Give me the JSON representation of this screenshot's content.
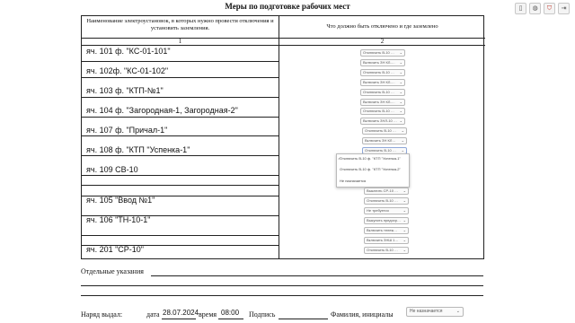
{
  "page_title": "Меры по подготовке рабочих мест",
  "toolbar": [
    {
      "name": "book-icon",
      "glyph": "▯"
    },
    {
      "name": "globe-icon",
      "glyph": "◍"
    },
    {
      "name": "shield-icon",
      "glyph": "⛉"
    },
    {
      "name": "exit-icon",
      "glyph": "⇥"
    }
  ],
  "table": {
    "header_left": "Наименование электроустановок, в которых нужно провести отключения и установить заземления.",
    "header_right": "Что должно быть отключено и где заземлено",
    "col1": "1",
    "col2": "2"
  },
  "rows": [
    {
      "label": "яч. 101 ф. \"КС-01-101\"",
      "selects": [
        "Отключить В-10 …",
        "Включить ЗН КЛ-…"
      ]
    },
    {
      "label": "яч. 102ф. \"КС-01-102\"",
      "selects": [
        "Отключить В-10 …",
        "Включить ЗН КЛ-…"
      ]
    },
    {
      "label": "яч. 103 ф. \"КТП-№1\"",
      "selects": [
        "Отключить В-10 …",
        "Включить ЗН КЛ-…"
      ]
    },
    {
      "label": "яч. 104 ф. \"Загородная-1, Загородная-2\"",
      "selects": [
        "Отключить В-10 …",
        "Включить ЗНЛ-10 …"
      ]
    },
    {
      "label": "яч. 107 ф. \"Причал-1\"",
      "selects": [
        "Отключить В-10 …",
        "Включить ЗН КЛ…"
      ]
    },
    {
      "label": "яч. 108 ф. \"КТП \"Успенка-1\"",
      "selects": [
        "Отключить В-10 …"
      ]
    },
    {
      "label": "яч. 109 СВ-10",
      "selects": []
    },
    {
      "label": "",
      "selects": [
        "Выкатить СР-10 …"
      ]
    },
    {
      "label": "яч. 105 \"Ввод №1\"",
      "selects": [
        "Отключить В-10 …",
        "Не требуется"
      ]
    },
    {
      "label": "яч. 106 \"ТН-10-1\"",
      "selects": [
        "Выкупить предохр…",
        "Включить тележ…"
      ]
    },
    {
      "label": "",
      "selects": [
        "Включить ЗНШ 1…"
      ]
    },
    {
      "label": "яч. 201 \"СР-10\"",
      "selects": [
        "Отключить В-10 …"
      ]
    }
  ],
  "dropdown": {
    "options": [
      {
        "label": "Отключить В-10 ф. \"КТП \"Успенка-1\"",
        "checked": true
      },
      {
        "label": "Отключить В-10 ф. \"КТП \"Успенка-2\"",
        "checked": false
      },
      {
        "label": "Не назначается",
        "checked": false
      }
    ]
  },
  "notes_label": "Отдельные указания",
  "footer": {
    "issued_label": "Наряд выдал:",
    "date_label": "дата",
    "date_value": "28.07.2024",
    "time_label": "время",
    "time_value": "08:00",
    "signature_label": "Подпись",
    "name_label": "Фамилия, инициалы",
    "name_select": "Не назначается"
  }
}
